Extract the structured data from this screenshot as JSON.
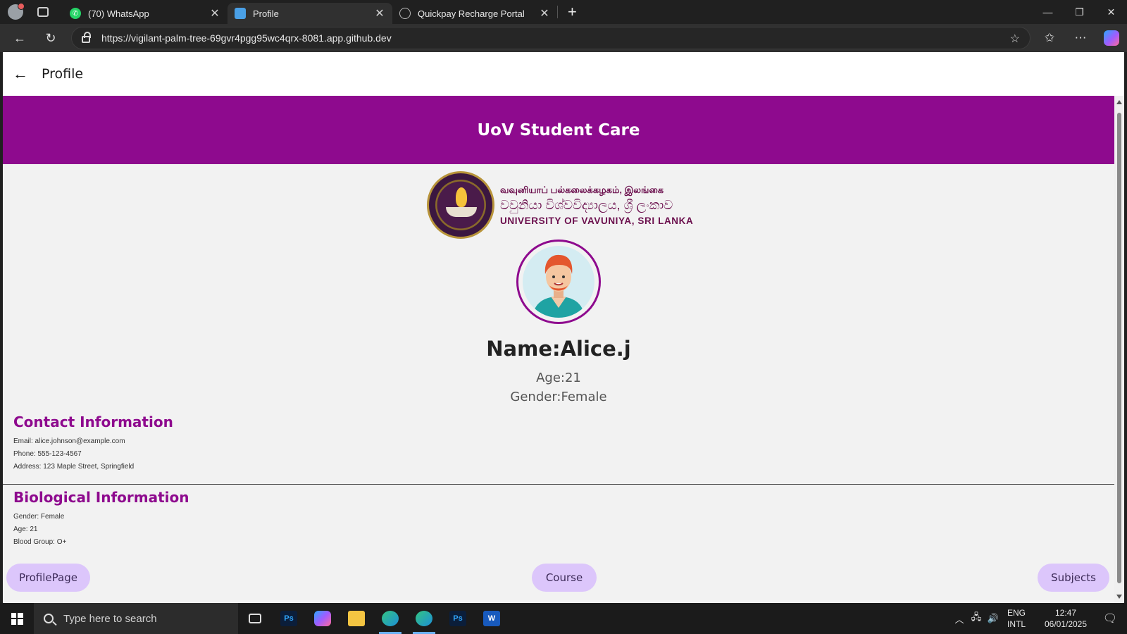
{
  "browser": {
    "tabs": [
      {
        "title": "(70) WhatsApp",
        "icon": "whatsapp-icon",
        "active": false
      },
      {
        "title": "Profile",
        "icon": "flutter-icon",
        "active": true
      },
      {
        "title": "Quickpay Recharge Portal",
        "icon": "globe-icon",
        "active": false
      }
    ],
    "url": "https://vigilant-palm-tree-69gvr4pgg95wc4qrx-8081.app.github.dev"
  },
  "app": {
    "page_title": "Profile",
    "banner_title": "UoV Student Care",
    "university": {
      "tamil": "வவுனியாப் பல்கலைக்கழகம், இலங்கை",
      "sinhala": "වවුනියා විශ්වවිද්‍යාලය, ශ්‍රී ලංකාව",
      "english": "UNIVERSITY OF VAVUNIYA, SRI LANKA"
    },
    "profile": {
      "name": "Name:Alice.j",
      "age": "Age:21",
      "gender": "Gender:Female"
    },
    "contact": {
      "title": "Contact Information",
      "email": "Email: alice.johnson@example.com",
      "phone": "Phone: 555-123-4567",
      "address": "Address: 123 Maple Street, Springfield"
    },
    "biological": {
      "title": "Biological Information",
      "gender": "Gender: Female",
      "age": "Age: 21",
      "blood_group": "Blood Group: O+"
    },
    "bottom_nav": {
      "profile": "ProfilePage",
      "course": "Course",
      "subjects": "Subjects"
    },
    "colors": {
      "primary": "#8e0a8e",
      "pill": "#dcc6fb"
    }
  },
  "taskbar": {
    "search_placeholder": "Type here to search",
    "lang_line1": "ENG",
    "lang_line2": "INTL",
    "time": "12:47",
    "date": "06/01/2025"
  }
}
